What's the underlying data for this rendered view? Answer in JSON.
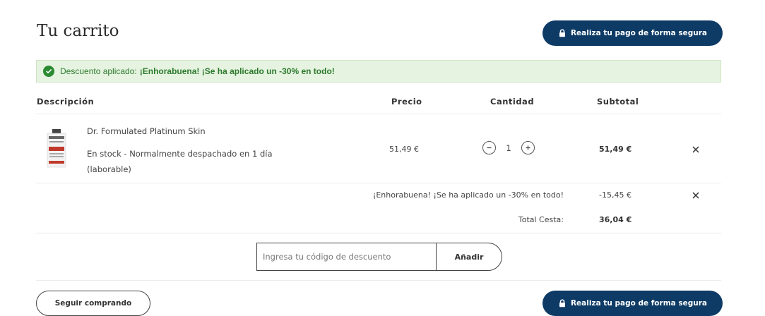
{
  "header": {
    "title": "Tu carrito",
    "pay_button": "Realiza tu pago de forma segura"
  },
  "banner": {
    "prefix": "Descuento aplicado:",
    "message": "¡Enhorabuena! ¡Se ha aplicado un -30% en todo!",
    "color": "#2d7a2d",
    "background": "#e5f3e0"
  },
  "columns": {
    "description": "Descripción",
    "price": "Precio",
    "quantity": "Cantidad",
    "subtotal": "Subtotal"
  },
  "item": {
    "name": "Dr. Formulated Platinum Skin",
    "stock": "En stock  -  Normalmente despachado en 1 día (laborable)",
    "price": "51,49 €",
    "quantity": "1",
    "subtotal": "51,49 €"
  },
  "discount": {
    "label": "¡Enhorabuena! ¡Se ha aplicado un -30% en todo!",
    "amount": "-15,45 €"
  },
  "total": {
    "label": "Total Cesta:",
    "amount": "36,04 €"
  },
  "coupon": {
    "placeholder": "Ingresa tu código de descuento",
    "button": "Añadir"
  },
  "footer": {
    "continue_button": "Seguir comprando",
    "pay_button": "Realiza tu pago de forma segura"
  },
  "colors": {
    "brand": "#0d3b66",
    "success": "#2a8a32"
  }
}
